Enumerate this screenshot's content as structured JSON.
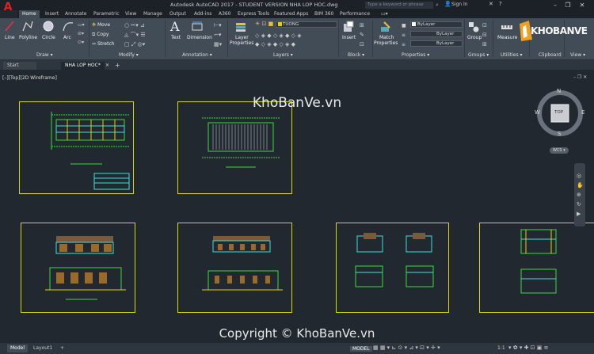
{
  "titlebar": {
    "title": "Autodesk AutoCAD 2017 - STUDENT VERSION    NHA LOP HOC.dwg",
    "search_placeholder": "Type a keyword or phrase",
    "signin": "Sign In",
    "minimize": "–",
    "restore": "❐",
    "close": "✕"
  },
  "ribbon_tabs": [
    "Home",
    "Insert",
    "Annotate",
    "Parametric",
    "View",
    "Manage",
    "Output",
    "Add-ins",
    "A360",
    "Express Tools",
    "Featured Apps",
    "BIM 360",
    "Performance"
  ],
  "draw": {
    "line": "Line",
    "polyline": "Polyline",
    "circle": "Circle",
    "arc": "Arc",
    "title": "Draw ▾"
  },
  "modify": {
    "move": "Move",
    "copy": "Copy",
    "stretch": "Stretch",
    "title": "Modify ▾"
  },
  "annotation": {
    "text": "Text",
    "dimension": "Dimension",
    "title": "Annotation ▾"
  },
  "layers": {
    "properties_l1": "Layer",
    "properties_l2": "Properties",
    "current_layer": "TUONG",
    "title": "Layers ▾"
  },
  "block": {
    "insert": "Insert",
    "title": "Block ▾"
  },
  "properties": {
    "match_l1": "Match",
    "match_l2": "Properties",
    "color": "ByLayer",
    "linetype": "ByLayer",
    "lineweight": "ByLayer",
    "title": "Properties ▾"
  },
  "groups": {
    "group": "Group",
    "title": "Groups ▾"
  },
  "utilities": {
    "measure": "Measure",
    "title": "Utilities ▾"
  },
  "clipboard": {
    "title": "Clipboard"
  },
  "view_panel": {
    "title": "View ▾"
  },
  "filetabs": {
    "start": "Start",
    "file": "NHA LOP HOC*",
    "add": "+"
  },
  "viewport": {
    "label": "[–][Top][2D Wireframe]"
  },
  "viewcube": {
    "n": "N",
    "s": "S",
    "e": "E",
    "w": "W",
    "top": "TOP",
    "wcs": "WCS ▾"
  },
  "layout_tabs": {
    "model": "Model",
    "layout1": "Layout1",
    "add": "+"
  },
  "status": {
    "model": "MODEL",
    "scale": "1:1"
  },
  "watermark": {
    "logo_text": "KHOBANVE",
    "text": "KhoBanVe.vn",
    "copyright": "Copyright © KhoBanVe.vn"
  },
  "colors": {
    "frame": "#d6d600",
    "drawing_green": "#3cdc3c",
    "drawing_cyan": "#40e0e0",
    "brown": "#9a6a2a"
  }
}
